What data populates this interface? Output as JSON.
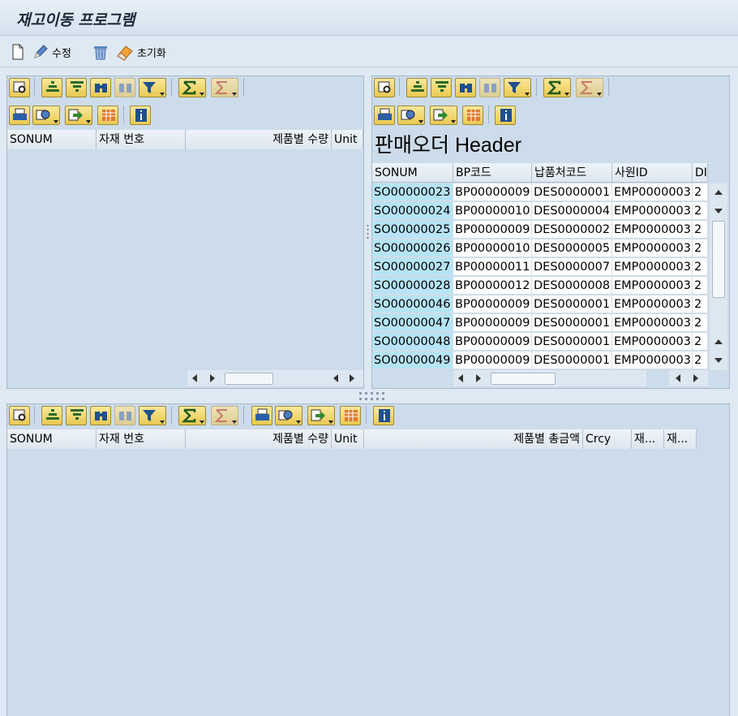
{
  "window": {
    "title": "재고이동 프로그램"
  },
  "toolbar": {
    "edit_label": "수정",
    "reset_label": "초기화"
  },
  "left_grid": {
    "columns": [
      "SONUM",
      "자재 번호",
      "제품별 수량",
      "Unit"
    ]
  },
  "right_grid": {
    "title": "판매오더 Header",
    "columns": [
      "SONUM",
      "BP코드",
      "납품처코드",
      "사원ID",
      "DI"
    ],
    "rows": [
      [
        "SO00000023",
        "BP00000009",
        "DES0000001",
        "EMP0000003",
        "2"
      ],
      [
        "SO00000024",
        "BP00000010",
        "DES0000004",
        "EMP0000003",
        "2"
      ],
      [
        "SO00000025",
        "BP00000009",
        "DES0000002",
        "EMP0000003",
        "2"
      ],
      [
        "SO00000026",
        "BP00000010",
        "DES0000005",
        "EMP0000003",
        "2"
      ],
      [
        "SO00000027",
        "BP00000011",
        "DES0000007",
        "EMP0000003",
        "2"
      ],
      [
        "SO00000028",
        "BP00000012",
        "DES0000008",
        "EMP0000003",
        "2"
      ],
      [
        "SO00000046",
        "BP00000009",
        "DES0000001",
        "EMP0000003",
        "2"
      ],
      [
        "SO00000047",
        "BP00000009",
        "DES0000001",
        "EMP0000003",
        "2"
      ],
      [
        "SO00000048",
        "BP00000009",
        "DES0000001",
        "EMP0000003",
        "2"
      ],
      [
        "SO00000049",
        "BP00000009",
        "DES0000001",
        "EMP0000003",
        "2"
      ]
    ]
  },
  "bottom_grid": {
    "columns": [
      "SONUM",
      "자재 번호",
      "제품별 수량",
      "Unit",
      "제품별 총금액",
      "Crcy",
      "재...",
      "재..."
    ]
  },
  "icons": {
    "grid_toolbar": [
      "details-icon",
      "sort-ascending-icon",
      "sort-descending-icon",
      "find-icon",
      "find-next-icon",
      "filter-icon",
      "sum-icon",
      "subtotal-icon",
      "print-icon",
      "views-icon",
      "export-icon",
      "layout-icon",
      "info-icon"
    ]
  },
  "colors": {
    "key_cell": "#b6e4f6",
    "panel_bg": "#cddcea",
    "button_gold": "#f1d56e"
  }
}
